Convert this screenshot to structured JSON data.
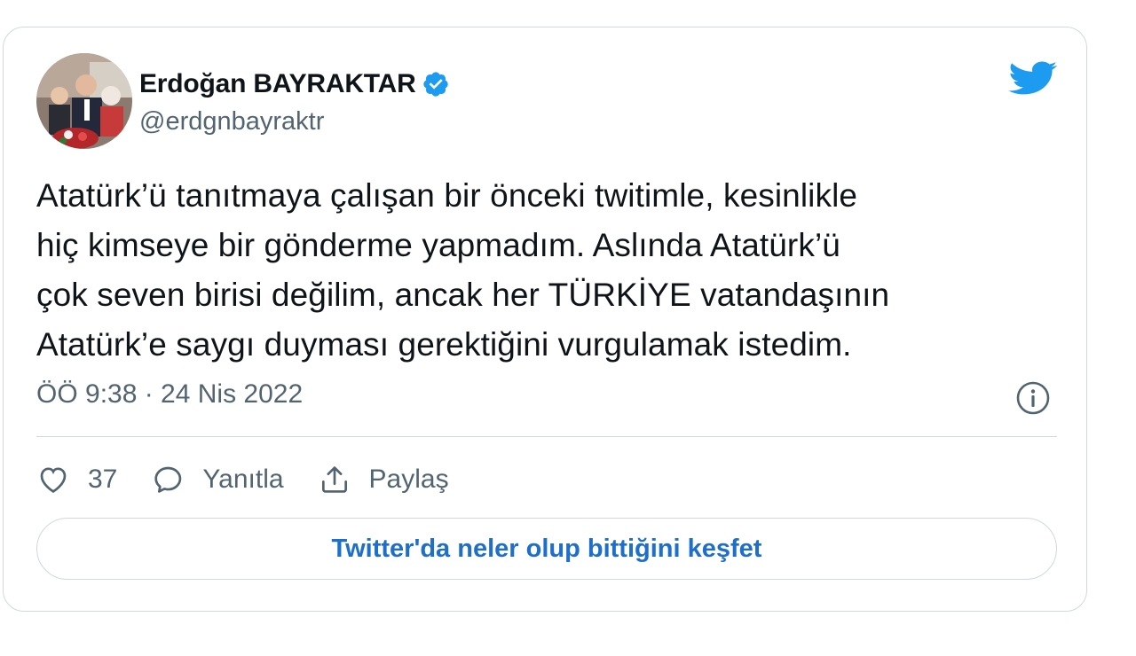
{
  "author": {
    "display_name": "Erdoğan BAYRAKTAR",
    "handle": "@erdgnbayraktr",
    "verified": true
  },
  "tweet": {
    "text_lines": [
      "Atatürk’ü tanıtmaya çalışan bir önceki twitimle, kesinlikle",
      "hiç kimseye bir gönderme yapmadım. Aslında Atatürk’ü",
      "çok seven birisi değilim, ancak her TÜRKİYE vatandaşının",
      "Atatürk’e saygı duyması gerektiğini vurgulamak istedim."
    ],
    "timestamp": "ÖÖ 9:38 · 24 Nis 2022"
  },
  "actions": {
    "like_count": "37",
    "reply_label": "Yanıtla",
    "share_label": "Paylaş"
  },
  "explore_button_label": "Twitter'da neler olup bittiğini keşfet",
  "icons": {
    "brand": "twitter-bird-icon",
    "verified": "verified-badge-icon",
    "info": "info-icon",
    "like": "heart-icon",
    "reply": "speech-bubble-icon",
    "share": "share-upload-icon"
  },
  "colors": {
    "brand_blue": "#1d9bf0",
    "link_blue": "#1d6fc9",
    "text_primary": "#0f1419",
    "text_secondary": "#536471",
    "border": "#cfd9de"
  }
}
